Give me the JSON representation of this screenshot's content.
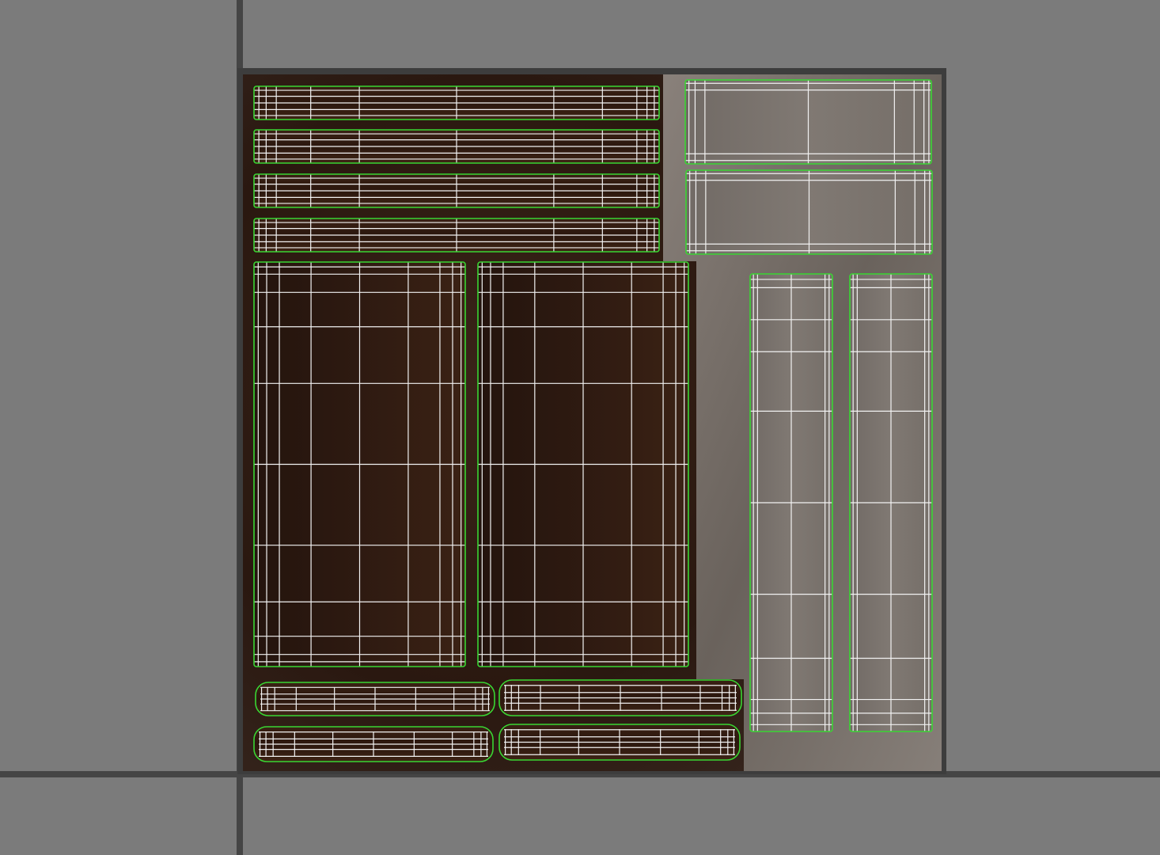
{
  "viewport": {
    "title": "",
    "background_color": "#7b7b7b",
    "axis_color": "#454545",
    "tile_border_color": "#3d3d3d"
  },
  "uv_display": {
    "shell_border_color": "#39d633",
    "edge_color": "#f2f2f2",
    "dark_wood_color": "#2e1a12",
    "dark_wood_highlight": "#4a2e1c",
    "light_stone_color": "#7a746f",
    "light_stone_highlight": "#9a938c"
  },
  "uv_shells": [
    {
      "id": "plank-1",
      "material": "dark-wood",
      "orientation": "horizontal",
      "subdivisions_u": 15,
      "subdivisions_v": 5,
      "rounded": false
    },
    {
      "id": "plank-2",
      "material": "dark-wood",
      "orientation": "horizontal",
      "subdivisions_u": 15,
      "subdivisions_v": 5,
      "rounded": false
    },
    {
      "id": "plank-3",
      "material": "dark-wood",
      "orientation": "horizontal",
      "subdivisions_u": 15,
      "subdivisions_v": 5,
      "rounded": false
    },
    {
      "id": "plank-4",
      "material": "dark-wood",
      "orientation": "horizontal",
      "subdivisions_u": 15,
      "subdivisions_v": 5,
      "rounded": false
    },
    {
      "id": "panel-left",
      "material": "dark-wood",
      "orientation": "vertical",
      "subdivisions_u": 8,
      "subdivisions_v": 9,
      "rounded": false
    },
    {
      "id": "panel-right",
      "material": "dark-wood",
      "orientation": "vertical",
      "subdivisions_u": 8,
      "subdivisions_v": 9,
      "rounded": false
    },
    {
      "id": "handle-1",
      "material": "dark-wood",
      "orientation": "horizontal",
      "subdivisions_u": 12,
      "subdivisions_v": 4,
      "rounded": true
    },
    {
      "id": "handle-2",
      "material": "dark-wood",
      "orientation": "horizontal",
      "subdivisions_u": 12,
      "subdivisions_v": 4,
      "rounded": true
    },
    {
      "id": "handle-3",
      "material": "dark-wood",
      "orientation": "horizontal",
      "subdivisions_u": 12,
      "subdivisions_v": 4,
      "rounded": true
    },
    {
      "id": "handle-4",
      "material": "dark-wood",
      "orientation": "horizontal",
      "subdivisions_u": 12,
      "subdivisions_v": 4,
      "rounded": true
    },
    {
      "id": "slab-top-1",
      "material": "light-stone",
      "orientation": "horizontal",
      "subdivisions_u": 6,
      "subdivisions_v": 4,
      "rounded": false
    },
    {
      "id": "slab-top-2",
      "material": "light-stone",
      "orientation": "horizontal",
      "subdivisions_u": 6,
      "subdivisions_v": 4,
      "rounded": false
    },
    {
      "id": "column-left",
      "material": "light-stone",
      "orientation": "vertical",
      "subdivisions_u": 5,
      "subdivisions_v": 9,
      "rounded": false
    },
    {
      "id": "column-right",
      "material": "light-stone",
      "orientation": "vertical",
      "subdivisions_u": 5,
      "subdivisions_v": 9,
      "rounded": false
    }
  ]
}
